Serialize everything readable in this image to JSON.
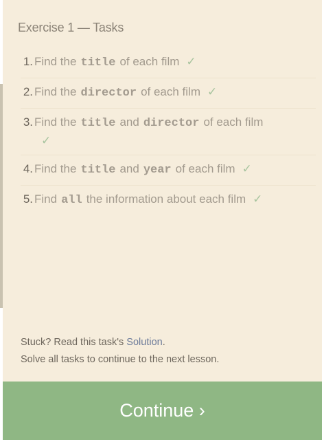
{
  "panel": {
    "title": "Exercise 1 — Tasks"
  },
  "tasks": [
    {
      "num": "1.",
      "before": "Find the",
      "code": "title",
      "after": "of each film",
      "check": "✓"
    },
    {
      "num": "2.",
      "before": "Find the",
      "code": "director",
      "after": "of each film",
      "check": "✓"
    },
    {
      "num": "3.",
      "before": "Find the",
      "code": "title",
      "middle": "and",
      "code2": "director",
      "after": "of each film",
      "check": "✓"
    },
    {
      "num": "4.",
      "before": "Find the",
      "code": "title",
      "middle": "and",
      "code2": "year",
      "after": "of each film",
      "check": "✓"
    },
    {
      "num": "5.",
      "before": "Find",
      "code": "all",
      "after": "the information about each film",
      "check": "✓"
    }
  ],
  "hint": {
    "stuck_prefix": "Stuck? Read this task's ",
    "solution_link": "Solution",
    "stuck_suffix": ".",
    "continue_note": "Solve all tasks to continue to the next lesson."
  },
  "continue_button": {
    "label": "Continue ›"
  },
  "colors": {
    "panel_bg": "#f6eddc",
    "check": "#a8c49f",
    "continue_bg": "#8fb784",
    "link": "#6b7a99"
  }
}
